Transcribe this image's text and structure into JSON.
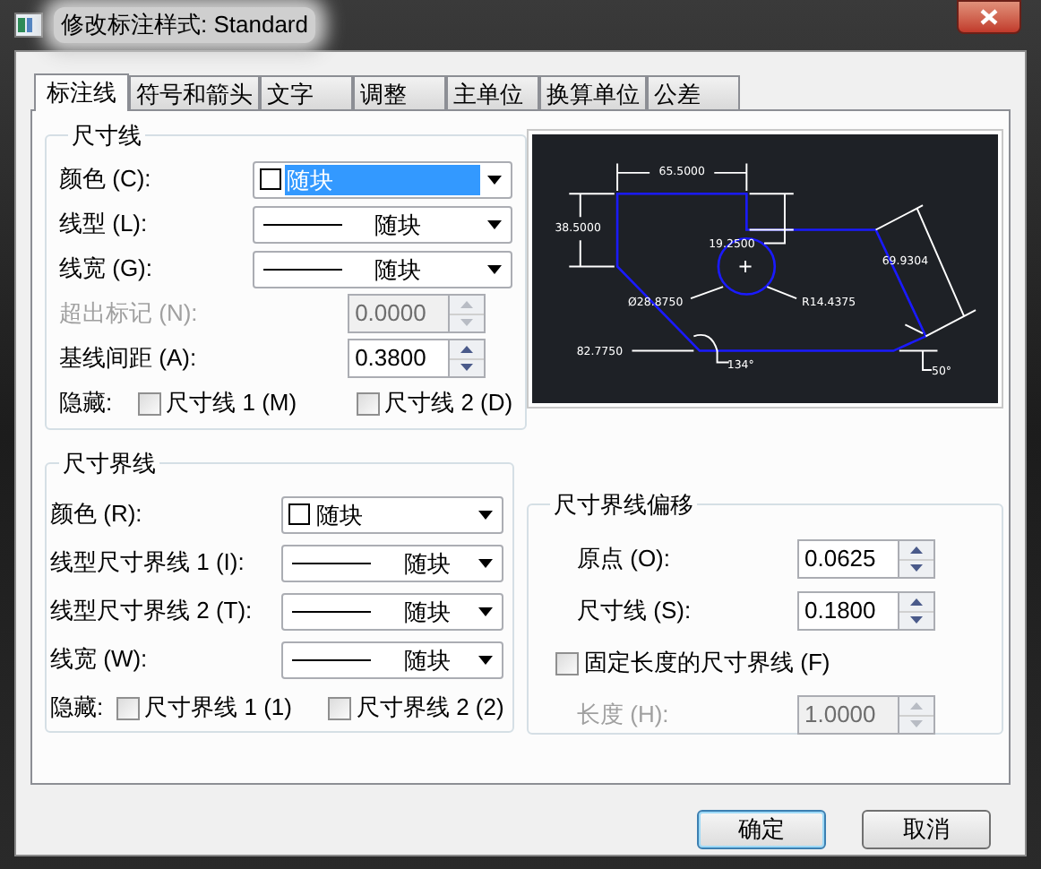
{
  "window": {
    "title": "修改标注样式: Standard"
  },
  "tabs": [
    {
      "label": "标注线",
      "selected": true
    },
    {
      "label": "符号和箭头",
      "selected": false
    },
    {
      "label": "文字",
      "selected": false
    },
    {
      "label": "调整",
      "selected": false
    },
    {
      "label": "主单位",
      "selected": false
    },
    {
      "label": "换算单位",
      "selected": false
    },
    {
      "label": "公差",
      "selected": false
    }
  ],
  "dimension_lines": {
    "title": "尺寸线",
    "rows": [
      {
        "kind": "color_combo",
        "label": "颜色 (C):",
        "value": "随块",
        "focused": true
      },
      {
        "kind": "line_combo",
        "label": "线型 (L):",
        "value": "随块",
        "focused": false
      },
      {
        "kind": "line_combo",
        "label": "线宽 (G):",
        "value": "随块",
        "focused": false
      },
      {
        "kind": "spin",
        "label": "超出标记 (N):",
        "value": "0.0000",
        "disabled": true
      },
      {
        "kind": "spin",
        "label": "基线间距 (A):",
        "value": "0.3800",
        "disabled": false
      },
      {
        "kind": "hide",
        "label": "隐藏:",
        "options": [
          {
            "label": "尺寸线 1 (M)",
            "checked": false
          },
          {
            "label": "尺寸线 2 (D)",
            "checked": false
          }
        ]
      }
    ]
  },
  "extension_lines": {
    "title": "尺寸界线",
    "rows": [
      {
        "kind": "color_combo",
        "label": "颜色 (R):",
        "value": "随块",
        "focused": false
      },
      {
        "kind": "line_combo",
        "label": "线型尺寸界线 1 (I):",
        "value": "随块",
        "focused": false
      },
      {
        "kind": "line_combo",
        "label": "线型尺寸界线 2 (T):",
        "value": "随块",
        "focused": false
      },
      {
        "kind": "line_combo",
        "label": "线宽 (W):",
        "value": "随块",
        "focused": false
      },
      {
        "kind": "hide",
        "label": "隐藏:",
        "options": [
          {
            "label": "尺寸界线 1 (1)",
            "checked": false
          },
          {
            "label": "尺寸界线 2 (2)",
            "checked": false
          }
        ]
      }
    ]
  },
  "preview": {
    "labels": [
      "65.5000",
      "38.5000",
      "19.2500",
      "Ø28.8750",
      "R14.4375",
      "82.7750",
      "134°",
      "69.9304",
      "50°"
    ]
  },
  "extension_offset": {
    "title": "尺寸界线偏移",
    "rows": [
      {
        "kind": "spin",
        "label": "原点 (O):",
        "value": "0.0625",
        "disabled": false
      },
      {
        "kind": "spin",
        "label": "尺寸线 (S):",
        "value": "0.1800",
        "disabled": false
      },
      {
        "kind": "check",
        "label": "固定长度的尺寸界线 (F)",
        "checked": false
      },
      {
        "kind": "spin",
        "label": "长度 (H):",
        "value": "1.0000",
        "disabled": true
      }
    ]
  },
  "buttons": [
    {
      "label": "确定",
      "focused": true
    },
    {
      "label": "取消",
      "focused": false
    }
  ]
}
